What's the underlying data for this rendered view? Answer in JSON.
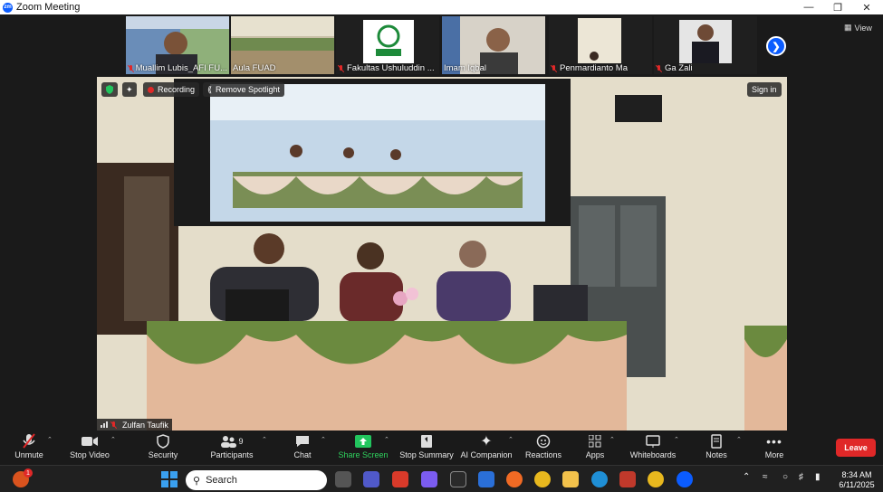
{
  "window": {
    "title": "Zoom Meeting",
    "logo_text": "zm"
  },
  "gallery": {
    "participants": [
      {
        "name": "Muallim Lubis_AFI FU...",
        "muted": true
      },
      {
        "name": "Aula FUAD",
        "muted": false
      },
      {
        "name": "Fakultas Ushuluddin ...",
        "muted": true
      },
      {
        "name": "Imam Iqbal",
        "muted": false
      },
      {
        "name": "Penmardianto Ma",
        "muted": true
      },
      {
        "name": "Ga Zali",
        "muted": true
      }
    ],
    "view_label": "View"
  },
  "main_video": {
    "recording_label": "Recording",
    "remove_spotlight_label": "Remove Spotlight",
    "sign_in_label": "Sign in",
    "speaker_name": "Zulfan Taufik"
  },
  "toolbar": {
    "unmute": "Unmute",
    "stop_video": "Stop Video",
    "security": "Security",
    "participants": "Participants",
    "participants_count": "9",
    "chat": "Chat",
    "share_screen": "Share Screen",
    "stop_summary": "Stop Summary",
    "ai_companion": "AI Companion",
    "reactions": "Reactions",
    "apps": "Apps",
    "whiteboards": "Whiteboards",
    "notes": "Notes",
    "more": "More",
    "leave": "Leave"
  },
  "taskbar": {
    "search_placeholder": "Search",
    "notification_count": "1",
    "time": "8:34 AM",
    "date": "6/11/2025"
  }
}
